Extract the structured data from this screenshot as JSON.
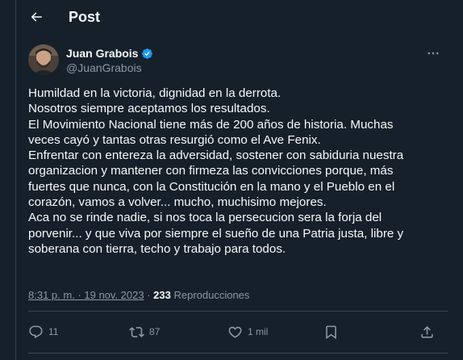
{
  "header": {
    "back_icon": "arrow-left-icon",
    "title": "Post"
  },
  "author": {
    "name": "Juan Grabois",
    "handle": "@JuanGrabois",
    "verified_icon": "verified-badge-icon",
    "verified_color": "#1d9bf0"
  },
  "post": {
    "lines": [
      "Humildad en la victoria, dignidad en la derrota.",
      "Nosotros siempre aceptamos los resultados.",
      "El Movimiento Nacional tiene más de 200 años de historia. Muchas",
      "veces cayó y tantas otras resurgió como el Ave Fenix.",
      "Enfrentar con entereza la adversidad, sostener con sabiduria nuestra",
      "organizacion y mantener con firmeza las convicciones porque, más",
      "fuertes que nunca, con la Constitución en la mano y el Pueblo en el",
      "corazón, vamos a volver... mucho, muchisimo mejores.",
      "Aca no se rinde nadie, si nos toca la persecucion sera la forja del",
      "porvenir... y que viva por siempre el sueño de una Patria justa, libre y",
      "soberana con tierra, techo y trabajo para todos."
    ],
    "time": "8:31 p. m.",
    "separator": " · ",
    "date": "19 nov. 2023",
    "views_count": "233",
    "views_label": " Reproducciones"
  },
  "actions": {
    "reply_count": "11",
    "repost_count": "87",
    "like_count": "1 mil",
    "bookmark_icon": "bookmark-icon",
    "share_icon": "share-icon"
  },
  "colors": {
    "background": "#15202b",
    "text": "#f7f9f9",
    "muted": "#8b98a5",
    "border": "#38444d",
    "accent": "#1d9bf0"
  }
}
